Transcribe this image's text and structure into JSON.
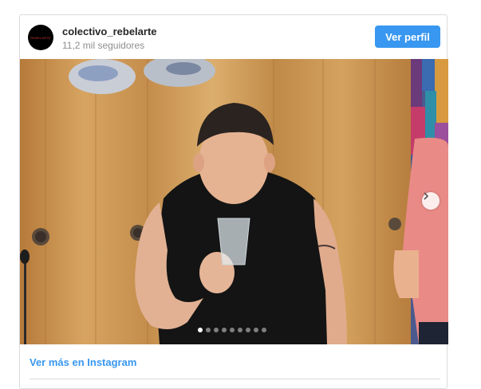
{
  "profile": {
    "username": "colectivo_rebelarte",
    "followers": "11,2 mil seguidores",
    "avatar_icon": "colectivo-logo-icon"
  },
  "header": {
    "view_profile_label": "Ver perfil"
  },
  "media": {
    "carousel_total": 9,
    "carousel_active_index": 0,
    "next_icon": "chevron-right-icon"
  },
  "footer": {
    "view_more_label": "Ver más en Instagram"
  },
  "colors": {
    "accent": "#3897f0",
    "text": "#262626",
    "muted": "#8e8e8e",
    "border": "#dbdbdb"
  }
}
